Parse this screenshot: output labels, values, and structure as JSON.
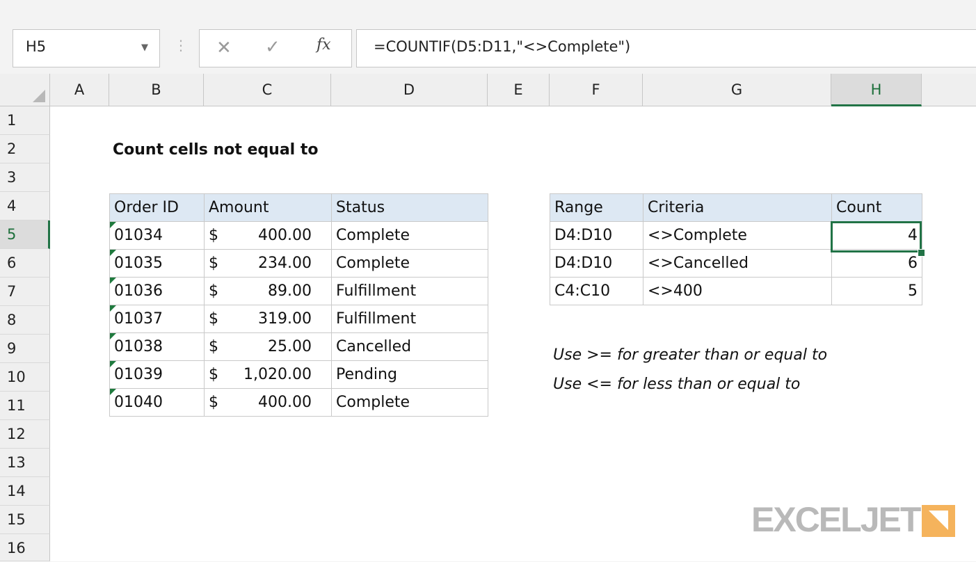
{
  "formula_bar": {
    "name_box": "H5",
    "cancel_glyph": "✕",
    "enter_glyph": "✓",
    "fx_label": "fx",
    "formula": "=COUNTIF(D5:D11,\"<>Complete\")"
  },
  "columns": [
    "A",
    "B",
    "C",
    "D",
    "E",
    "F",
    "G",
    "H"
  ],
  "rows": [
    "1",
    "2",
    "3",
    "4",
    "5",
    "6",
    "7",
    "8",
    "9",
    "10",
    "11",
    "12",
    "13",
    "14",
    "15",
    "16"
  ],
  "selected_column": "H",
  "selected_row": "5",
  "title": "Count cells not equal to",
  "orders_table": {
    "headers": [
      "Order ID",
      "Amount",
      "Status"
    ],
    "rows": [
      {
        "id": "01034",
        "currency": "$",
        "amount": "400.00",
        "status": "Complete"
      },
      {
        "id": "01035",
        "currency": "$",
        "amount": "234.00",
        "status": "Complete"
      },
      {
        "id": "01036",
        "currency": "$",
        "amount": "89.00",
        "status": "Fulfillment"
      },
      {
        "id": "01037",
        "currency": "$",
        "amount": "319.00",
        "status": "Fulfillment"
      },
      {
        "id": "01038",
        "currency": "$",
        "amount": "25.00",
        "status": "Cancelled"
      },
      {
        "id": "01039",
        "currency": "$",
        "amount": "1,020.00",
        "status": "Pending"
      },
      {
        "id": "01040",
        "currency": "$",
        "amount": "400.00",
        "status": "Complete"
      }
    ]
  },
  "count_table": {
    "headers": [
      "Range",
      "Criteria",
      "Count"
    ],
    "rows": [
      {
        "range": "D4:D10",
        "criteria": "<>Complete",
        "count": "4"
      },
      {
        "range": "D4:D10",
        "criteria": "<>Cancelled",
        "count": "6"
      },
      {
        "range": "C4:C10",
        "criteria": "<>400",
        "count": "5"
      }
    ]
  },
  "notes": [
    "Use >= for greater than or equal to",
    "Use <= for less than or equal to"
  ],
  "logo": "EXCELJET",
  "colors": {
    "accent_green": "#217346",
    "header_fill": "#dde8f3",
    "logo_orange": "#f5b35c"
  }
}
